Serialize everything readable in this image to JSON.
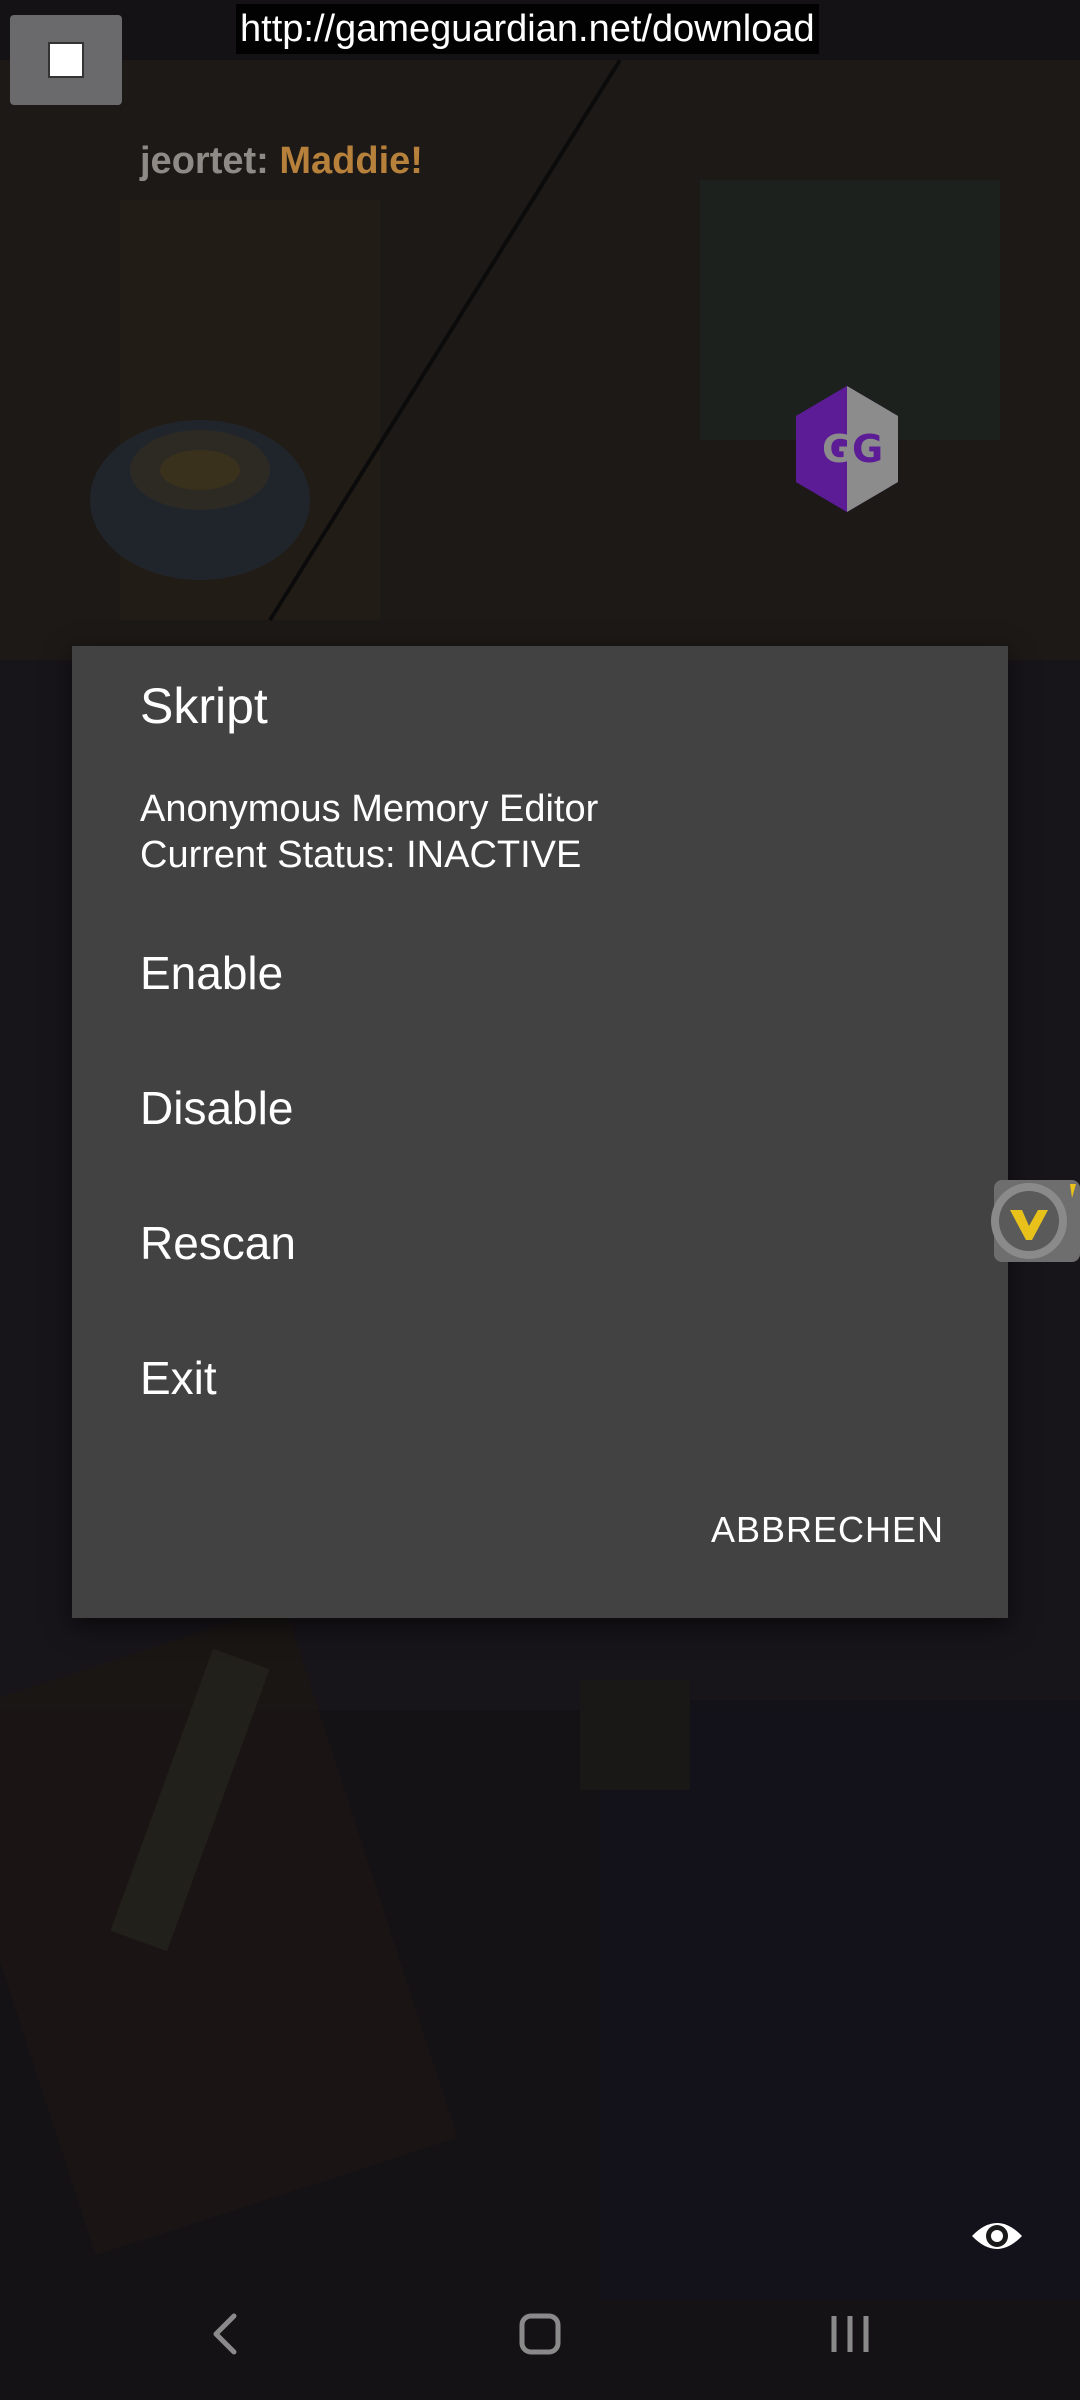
{
  "overlay": {
    "url": "http://gameguardian.net/download"
  },
  "game": {
    "chat_prefix": "jeortet: ",
    "chat_name": "Maddie!"
  },
  "dialog": {
    "title": "Skript",
    "message_lines": [
      "Anonymous Memory Editor",
      "Current Status: INACTIVE"
    ],
    "items": [
      {
        "label": "Enable"
      },
      {
        "label": "Disable"
      },
      {
        "label": "Rescan"
      },
      {
        "label": "Exit"
      }
    ],
    "cancel_label": "ABBRECHEN"
  },
  "icons": {
    "stop": "stop-square-icon",
    "gg": "gameguardian-logo-icon",
    "v": "v-floating-icon",
    "eye": "eye-icon",
    "back": "back-icon",
    "home": "home-icon",
    "recents": "recents-icon"
  },
  "colors": {
    "dialog_bg": "#424242",
    "gg_purple": "#6a1fa8",
    "v_yellow": "#e8c11a"
  }
}
